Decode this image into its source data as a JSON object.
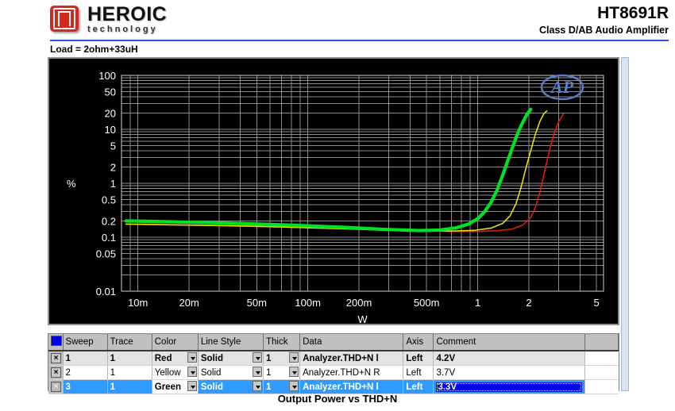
{
  "header": {
    "brand_name": "HEROIC",
    "brand_sub": "technology",
    "part_number": "HT8691R",
    "part_description": "Class D/AB Audio Amplifier",
    "accent_color": "#2255dd",
    "logo_color": "#d6281e"
  },
  "plot": {
    "load_label": "Load = 2ohm+33uH",
    "watermark": "AP",
    "watermark_color": "#5b7fc7",
    "bg_color": "#000000",
    "grid_color": "#8c8c8c"
  },
  "caption": "Output Power vs THD+N",
  "table": {
    "columns": [
      "",
      "Sweep",
      "Trace",
      "Color",
      "Line Style",
      "Thick",
      "Data",
      "Axis",
      "Comment"
    ],
    "rows": [
      {
        "close": "×",
        "sweep": "1",
        "trace": "1",
        "color": "Red",
        "line_style": "Solid",
        "thick": "1",
        "data": "Analyzer.THD+N l",
        "axis": "Left",
        "comment": "4.2V",
        "state": "normal"
      },
      {
        "close": "×",
        "sweep": "2",
        "trace": "1",
        "color": "Yellow",
        "line_style": "Solid",
        "thick": "1",
        "data": "Analyzer.THD+N R",
        "axis": "Left",
        "comment": "3.7V",
        "state": "normal"
      },
      {
        "close": "×",
        "sweep": "3",
        "trace": "1",
        "color": "Green",
        "line_style": "Solid",
        "thick": "1",
        "data": "Analyzer.THD+N l",
        "axis": "Left",
        "comment": "3.3V",
        "state": "selected"
      }
    ]
  },
  "chart_data": {
    "type": "line",
    "title": "Output Power vs THD+N",
    "subtitle": "Load = 2ohm+33uH",
    "xlabel": "W",
    "ylabel": "%",
    "xscale": "log",
    "yscale": "log",
    "xlim": [
      0.008,
      5.5
    ],
    "ylim": [
      0.01,
      100
    ],
    "xticks": [
      0.01,
      0.02,
      0.05,
      0.1,
      0.2,
      0.5,
      1,
      2,
      5
    ],
    "xticklabels": [
      "10m",
      "20m",
      "50m",
      "100m",
      "200m",
      "500m",
      "1",
      "2",
      "5"
    ],
    "yticks": [
      0.01,
      0.05,
      0.1,
      0.2,
      0.5,
      1,
      2,
      5,
      10,
      20,
      50,
      100
    ],
    "yticklabels": [
      "0.01",
      "0.05",
      "0.1",
      "0.2",
      "0.5",
      "1",
      "2",
      "5",
      "10",
      "20",
      "50",
      "100"
    ],
    "grid": true,
    "legend": false,
    "series": [
      {
        "name": "4.2V",
        "color": "#e01b10",
        "width": 1.6,
        "x": [
          0.0085,
          0.012,
          0.02,
          0.035,
          0.06,
          0.1,
          0.17,
          0.28,
          0.45,
          0.7,
          1.0,
          1.3,
          1.6,
          1.85,
          2.05,
          2.2,
          2.35,
          2.5,
          2.65,
          2.8,
          3.0,
          3.2
        ],
        "y": [
          0.175,
          0.172,
          0.168,
          0.163,
          0.157,
          0.15,
          0.143,
          0.136,
          0.131,
          0.128,
          0.128,
          0.132,
          0.142,
          0.17,
          0.23,
          0.38,
          0.8,
          1.9,
          4.2,
          8.0,
          14.0,
          19.5
        ]
      },
      {
        "name": "3.7V",
        "color": "#e8e000",
        "width": 1.6,
        "x": [
          0.0085,
          0.012,
          0.02,
          0.035,
          0.06,
          0.1,
          0.17,
          0.28,
          0.45,
          0.7,
          0.95,
          1.2,
          1.4,
          1.55,
          1.68,
          1.8,
          1.92,
          2.05,
          2.18,
          2.32,
          2.45,
          2.55
        ],
        "y": [
          0.175,
          0.172,
          0.168,
          0.163,
          0.157,
          0.15,
          0.143,
          0.136,
          0.131,
          0.13,
          0.134,
          0.148,
          0.18,
          0.25,
          0.42,
          0.85,
          1.9,
          4.0,
          8.0,
          14.0,
          19.5,
          22.0
        ]
      },
      {
        "name": "3.3V",
        "color": "#00e024",
        "width": 4.2,
        "x": [
          0.0085,
          0.012,
          0.02,
          0.035,
          0.06,
          0.1,
          0.17,
          0.28,
          0.45,
          0.6,
          0.75,
          0.88,
          1.0,
          1.1,
          1.2,
          1.3,
          1.4,
          1.5,
          1.6,
          1.72,
          1.85,
          1.95,
          2.05
        ],
        "y": [
          0.2,
          0.197,
          0.19,
          0.182,
          0.173,
          0.163,
          0.152,
          0.14,
          0.133,
          0.136,
          0.15,
          0.175,
          0.22,
          0.3,
          0.45,
          0.75,
          1.4,
          2.6,
          4.6,
          8.5,
          14.0,
          19.0,
          23.5
        ]
      }
    ]
  }
}
